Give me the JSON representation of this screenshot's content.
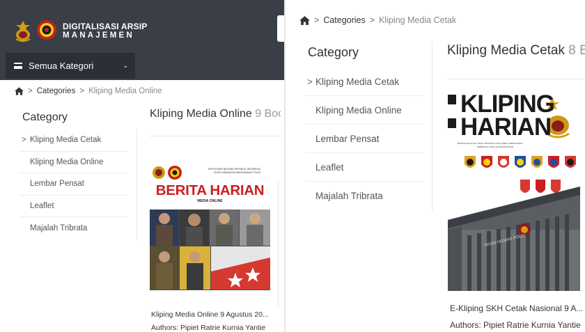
{
  "header": {
    "brand_title": "DIGITALISASI ARSIP",
    "brand_subtitle": "MANAJEMEN",
    "category_button_label": "Semua Kategori",
    "colors": {
      "bg": "#3a3f47",
      "button_bg": "#2b2f36"
    }
  },
  "left_panel": {
    "breadcrumb": {
      "categories": "Categories",
      "current": "Kliping Media Online",
      "separator": ">"
    },
    "category_heading": "Category",
    "categories": [
      {
        "label": "Kliping Media Cetak",
        "chevron": ">"
      },
      {
        "label": "Kliping Media Online",
        "chevron": ""
      },
      {
        "label": "Lembar Pensat",
        "chevron": ""
      },
      {
        "label": "Leaflet",
        "chevron": ""
      },
      {
        "label": "Majalah Tribrata",
        "chevron": ""
      }
    ],
    "section_title": "Kliping Media Online",
    "section_count": "9 Boo",
    "book": {
      "cover_header": "KEPOLISIAN NEGARA REPUBLIK INDONESIA",
      "cover_subheader": "DIVISI HUBUNGAN MASYARAKAT POLRI",
      "cover_title": "BERITA HARIAN",
      "cover_subtitle": "MEDIA ONLINE",
      "caption_title": "Kliping Media Online 9 Agustus 20...",
      "caption_authors": "Authors: Pipiet Ratrie Kurnia Yantie"
    }
  },
  "right_panel": {
    "breadcrumb": {
      "categories": "Categories",
      "current": "Kliping Media Cetak",
      "separator": ">"
    },
    "category_heading": "Category",
    "categories": [
      {
        "label": "Kliping Media Cetak",
        "chevron": ">"
      },
      {
        "label": "Kliping Media Online",
        "chevron": ""
      },
      {
        "label": "Lembar Pensat",
        "chevron": ""
      },
      {
        "label": "Leaflet",
        "chevron": ""
      },
      {
        "label": "Majalah Tribrata",
        "chevron": ""
      }
    ],
    "section_title": "Kliping Media Cetak",
    "section_count": "8 Bo",
    "book": {
      "cover_title_1": "KLIPING",
      "cover_title_2": "HARIAN",
      "cover_tagline": "BERITA AKTUAL YANG PENTING DAN PERLU DIKETAHUI",
      "cover_tagline_2": "PIMPINAN DAN JAJARAN POLRI",
      "building_label": "DIVISI HUMAS POLRI",
      "caption_title": "E-Kliping SKH Cetak Nasional 9 A...",
      "caption_authors": "Authors: Pipiet Ratrie Kurnia Yantie"
    }
  },
  "icons": [
    "home-icon",
    "chevron-right-icon",
    "chevron-down-icon",
    "hamburger-icon",
    "polri-logo",
    "divhumas-logo"
  ]
}
